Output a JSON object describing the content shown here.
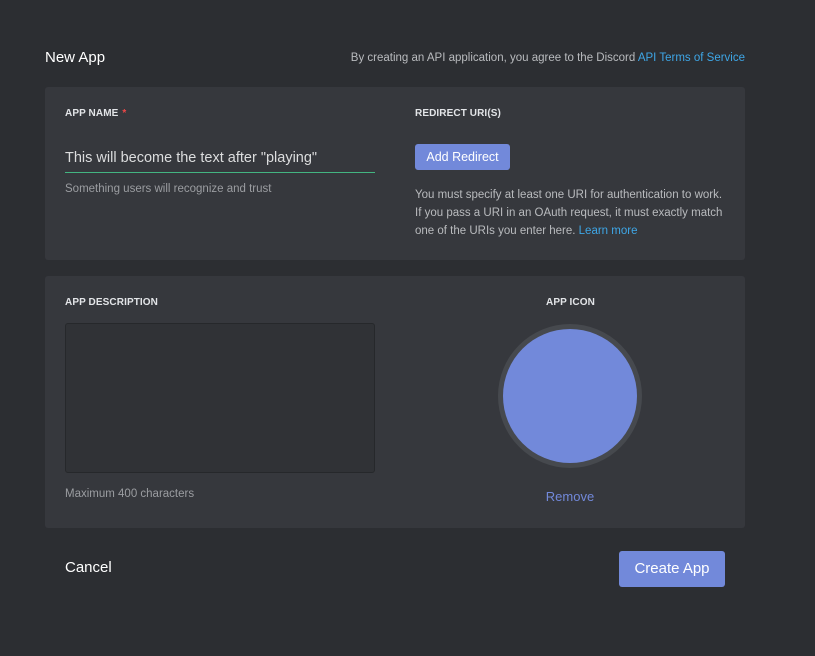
{
  "header": {
    "title": "New App",
    "terms_prefix": "By creating an API application, you agree to the Discord ",
    "terms_link": "API Terms of Service"
  },
  "app_name": {
    "label": "APP NAME",
    "required_marker": "*",
    "value": "This will become the text after \"playing\"",
    "hint": "Something users will recognize and trust"
  },
  "redirect": {
    "label": "REDIRECT URI(S)",
    "add_button": "Add Redirect",
    "help_text": "You must specify at least one URI for authentication to work. If you pass a URI in an OAuth request, it must exactly match one of the URIs you enter here. ",
    "learn_more": "Learn more"
  },
  "description": {
    "label": "APP DESCRIPTION",
    "value": "",
    "hint": "Maximum 400 characters"
  },
  "app_icon": {
    "label": "APP ICON",
    "remove_label": "Remove",
    "color": "#7289da"
  },
  "footer": {
    "cancel_label": "Cancel",
    "create_label": "Create App"
  },
  "colors": {
    "accent": "#7289da",
    "link": "#3ea6e6",
    "required": "#f04747",
    "input_underline": "#43b581"
  }
}
